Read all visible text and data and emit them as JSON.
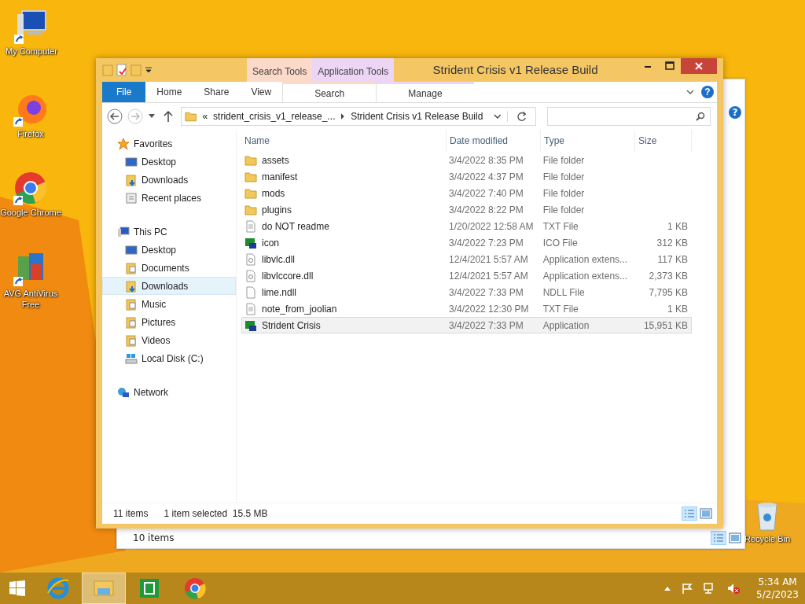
{
  "desktop_icons": [
    {
      "label": "My Computer",
      "kind": "computer"
    },
    {
      "label": "Firefox",
      "kind": "firefox"
    },
    {
      "label": "Google Chrome",
      "kind": "chrome"
    },
    {
      "label": "AVG AntiVirus Free",
      "kind": "avg"
    },
    {
      "label": "Recycle Bin",
      "kind": "bin"
    }
  ],
  "background_window": {
    "status": "10 items",
    "help": "?"
  },
  "window": {
    "title": "Strident Crisis v1 Release Build",
    "context_tabs": [
      {
        "label": "Search Tools",
        "color": "#fcd9c8"
      },
      {
        "label": "Application Tools",
        "color": "#ecd5f5"
      }
    ],
    "tabs": [
      {
        "label": "File",
        "kind": "file"
      },
      {
        "label": "Home",
        "kind": "plain"
      },
      {
        "label": "Share",
        "kind": "plain"
      },
      {
        "label": "View",
        "kind": "plain"
      },
      {
        "label": "Search",
        "kind": "context"
      },
      {
        "label": "Manage",
        "kind": "context"
      }
    ],
    "breadcrumb": [
      "«",
      "strident_crisis_v1_release_...",
      "Strident Crisis v1 Release Build"
    ],
    "help": "?",
    "nav": [
      {
        "label": "Favorites",
        "kind": "star",
        "selected": false,
        "children": [
          {
            "label": "Desktop",
            "kind": "desktop",
            "selected": false
          },
          {
            "label": "Downloads",
            "kind": "downloads",
            "selected": false
          },
          {
            "label": "Recent places",
            "kind": "recent",
            "selected": false
          }
        ]
      },
      {
        "label": "This PC",
        "kind": "pc",
        "selected": false,
        "children": [
          {
            "label": "Desktop",
            "kind": "desktop",
            "selected": false
          },
          {
            "label": "Documents",
            "kind": "documents",
            "selected": false
          },
          {
            "label": "Downloads",
            "kind": "downloads",
            "selected": true
          },
          {
            "label": "Music",
            "kind": "music",
            "selected": false
          },
          {
            "label": "Pictures",
            "kind": "pictures",
            "selected": false
          },
          {
            "label": "Videos",
            "kind": "videos",
            "selected": false
          },
          {
            "label": "Local Disk (C:)",
            "kind": "disk",
            "selected": false
          }
        ]
      },
      {
        "label": "Network",
        "kind": "network",
        "selected": false
      }
    ],
    "columns": [
      "Name",
      "Date modified",
      "Type",
      "Size"
    ],
    "rows": [
      {
        "name": "assets",
        "date": "3/4/2022 8:35 PM",
        "type": "File folder",
        "size": "",
        "kind": "folder",
        "selected": false
      },
      {
        "name": "manifest",
        "date": "3/4/2022 4:37 PM",
        "type": "File folder",
        "size": "",
        "kind": "folder",
        "selected": false
      },
      {
        "name": "mods",
        "date": "3/4/2022 7:40 PM",
        "type": "File folder",
        "size": "",
        "kind": "folder",
        "selected": false
      },
      {
        "name": "plugins",
        "date": "3/4/2022 8:22 PM",
        "type": "File folder",
        "size": "",
        "kind": "folder",
        "selected": false
      },
      {
        "name": "do NOT readme",
        "date": "1/20/2022 12:58 AM",
        "type": "TXT File",
        "size": "1 KB",
        "kind": "text",
        "selected": false
      },
      {
        "name": "icon",
        "date": "3/4/2022 7:23 PM",
        "type": "ICO File",
        "size": "312 KB",
        "kind": "app",
        "selected": false
      },
      {
        "name": "libvlc.dll",
        "date": "12/4/2021 5:57 AM",
        "type": "Application extens...",
        "size": "117 KB",
        "kind": "dll",
        "selected": false
      },
      {
        "name": "libvlccore.dll",
        "date": "12/4/2021 5:57 AM",
        "type": "Application extens...",
        "size": "2,373 KB",
        "kind": "dll",
        "selected": false
      },
      {
        "name": "lime.ndll",
        "date": "3/4/2022 7:33 PM",
        "type": "NDLL File",
        "size": "7,795 KB",
        "kind": "blank",
        "selected": false
      },
      {
        "name": "note_from_joolian",
        "date": "3/4/2022 12:30 PM",
        "type": "TXT File",
        "size": "1 KB",
        "kind": "text",
        "selected": false
      },
      {
        "name": "Strident Crisis",
        "date": "3/4/2022 7:33 PM",
        "type": "Application",
        "size": "15,951 KB",
        "kind": "app",
        "selected": true
      }
    ],
    "status": {
      "count": "11 items",
      "selection": "1 item selected  15.5 MB"
    }
  },
  "taskbar": {
    "apps": [
      {
        "kind": "ie",
        "active": false
      },
      {
        "kind": "explorer",
        "active": true
      },
      {
        "kind": "store",
        "active": false
      },
      {
        "kind": "chrome",
        "active": false
      }
    ],
    "time": "5:34 AM",
    "date": "5/2/2023"
  }
}
